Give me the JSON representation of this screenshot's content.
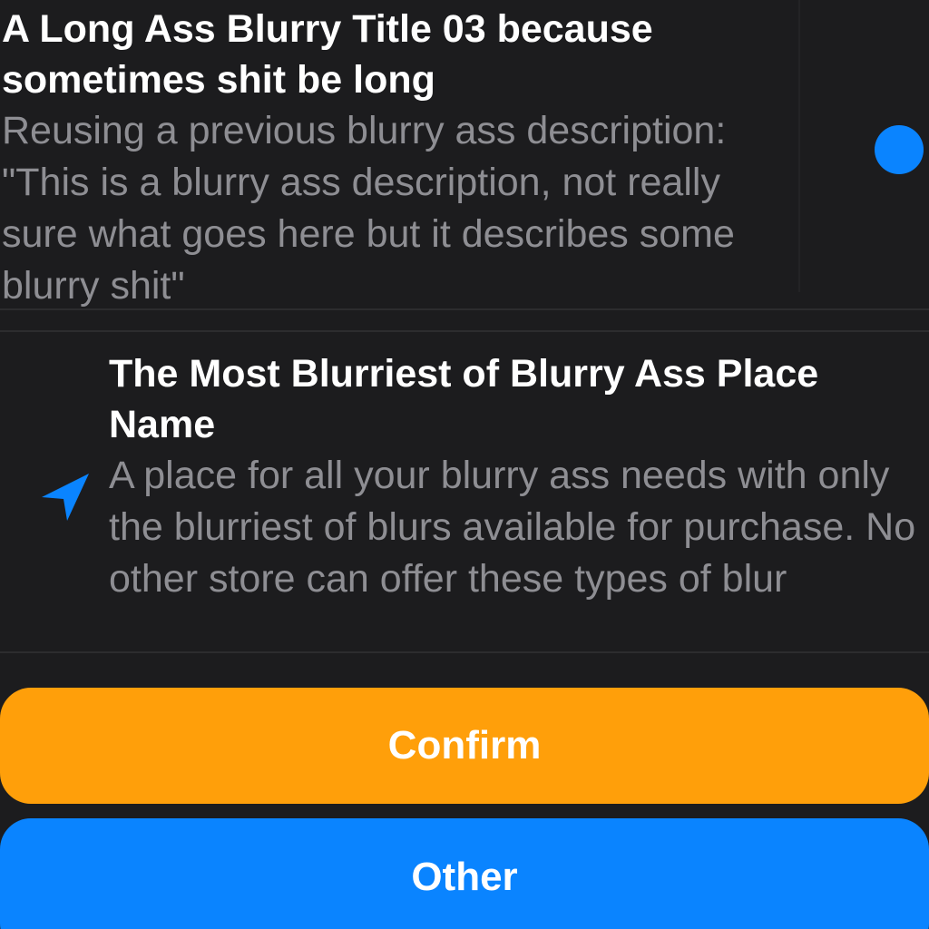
{
  "card1": {
    "title": "A Long Ass Blurry Title 03 because sometimes shit be long",
    "description": "Reusing a previous blurry ass description: \"This is a blurry ass description, not really sure what goes here but it describes some blurry shit\"",
    "indicator": "unread-dot",
    "indicator_color": "#0a84ff"
  },
  "card2": {
    "icon": "location-arrow-icon",
    "icon_color": "#0a84ff",
    "title": "The Most Blurriest of Blurry Ass Place Name",
    "description": "A place for all your blurry ass needs with only the blurriest of blurs available for purchase. No other store can offer these types of blur"
  },
  "buttons": {
    "confirm_label": "Confirm",
    "confirm_color": "#ff9f0a",
    "other_label": "Other",
    "other_color": "#0a84ff"
  }
}
